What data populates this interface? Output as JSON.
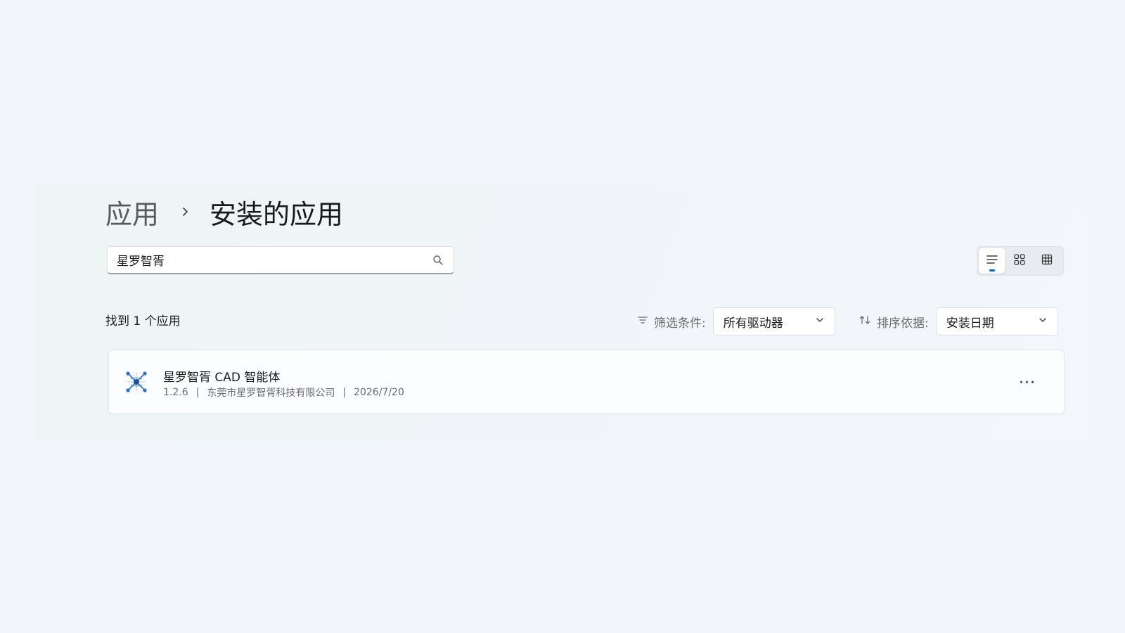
{
  "breadcrumb": {
    "parent": "应用",
    "current": "安装的应用"
  },
  "search": {
    "value": "星罗智胥",
    "icon": "search-icon"
  },
  "view_modes": [
    {
      "name": "list",
      "icon": "list-view-icon",
      "active": true
    },
    {
      "name": "tiles",
      "icon": "tile-view-icon",
      "active": false
    },
    {
      "name": "grid",
      "icon": "grid-view-icon",
      "active": false
    }
  ],
  "results": {
    "count_text": "找到 1 个应用"
  },
  "filter": {
    "icon": "filter-icon",
    "label": "筛选条件:",
    "value": "所有驱动器"
  },
  "sort": {
    "icon": "sort-icon",
    "label": "排序依据:",
    "value": "安装日期"
  },
  "apps": [
    {
      "name": "星罗智胥 CAD 智能体",
      "version": "1.2.6",
      "publisher": "东莞市星罗智胥科技有限公司",
      "date": "2026/7/20",
      "separator": "|",
      "more_label": "···"
    }
  ],
  "colors": {
    "accent": "#0067c0",
    "background": "#f2f5fa",
    "card": "#fcfdfe"
  }
}
